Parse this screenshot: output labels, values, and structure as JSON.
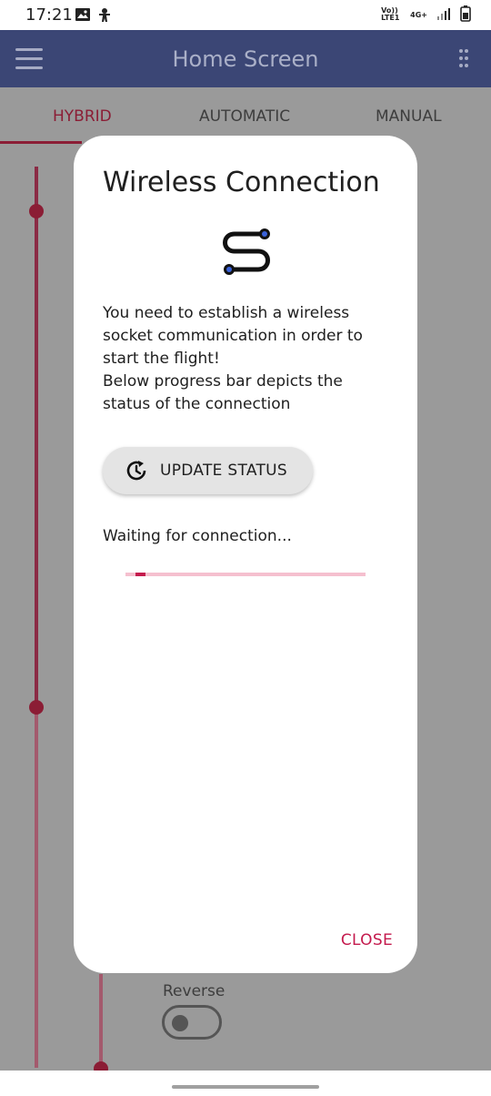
{
  "status_bar": {
    "time": "17:21",
    "left_icons": [
      "image-icon",
      "accessibility-icon"
    ],
    "volte": "Vo)) LTE1",
    "network": "4G+",
    "right_icons": [
      "signal-icon",
      "battery-icon"
    ]
  },
  "app_bar": {
    "title": "Home Screen",
    "menu_icon": "hamburger-icon",
    "overflow_icon": "overflow-dots-icon"
  },
  "tabs": [
    {
      "label": "HYBRID",
      "active": true
    },
    {
      "label": "AUTOMATIC",
      "active": false
    },
    {
      "label": "MANUAL",
      "active": false
    }
  ],
  "background": {
    "reverse_label": "Reverse",
    "reverse_toggle_on": false
  },
  "dialog": {
    "title": "Wireless Connection",
    "icon": "connection-path-icon",
    "body_lines": [
      "You need to establish a wireless socket communication in order to start the flight!",
      "Below progress bar depicts the status of the connection"
    ],
    "update_button": {
      "label": "UPDATE STATUS",
      "icon": "update-clock-icon"
    },
    "waiting_text": "Waiting for connection...",
    "progress": 0.04,
    "close_label": "CLOSE"
  },
  "colors": {
    "app_bar": "#3b4675",
    "accent": "#c41a4d",
    "tab_active": "#8b1d35",
    "progress_track": "#f5c0cf"
  }
}
